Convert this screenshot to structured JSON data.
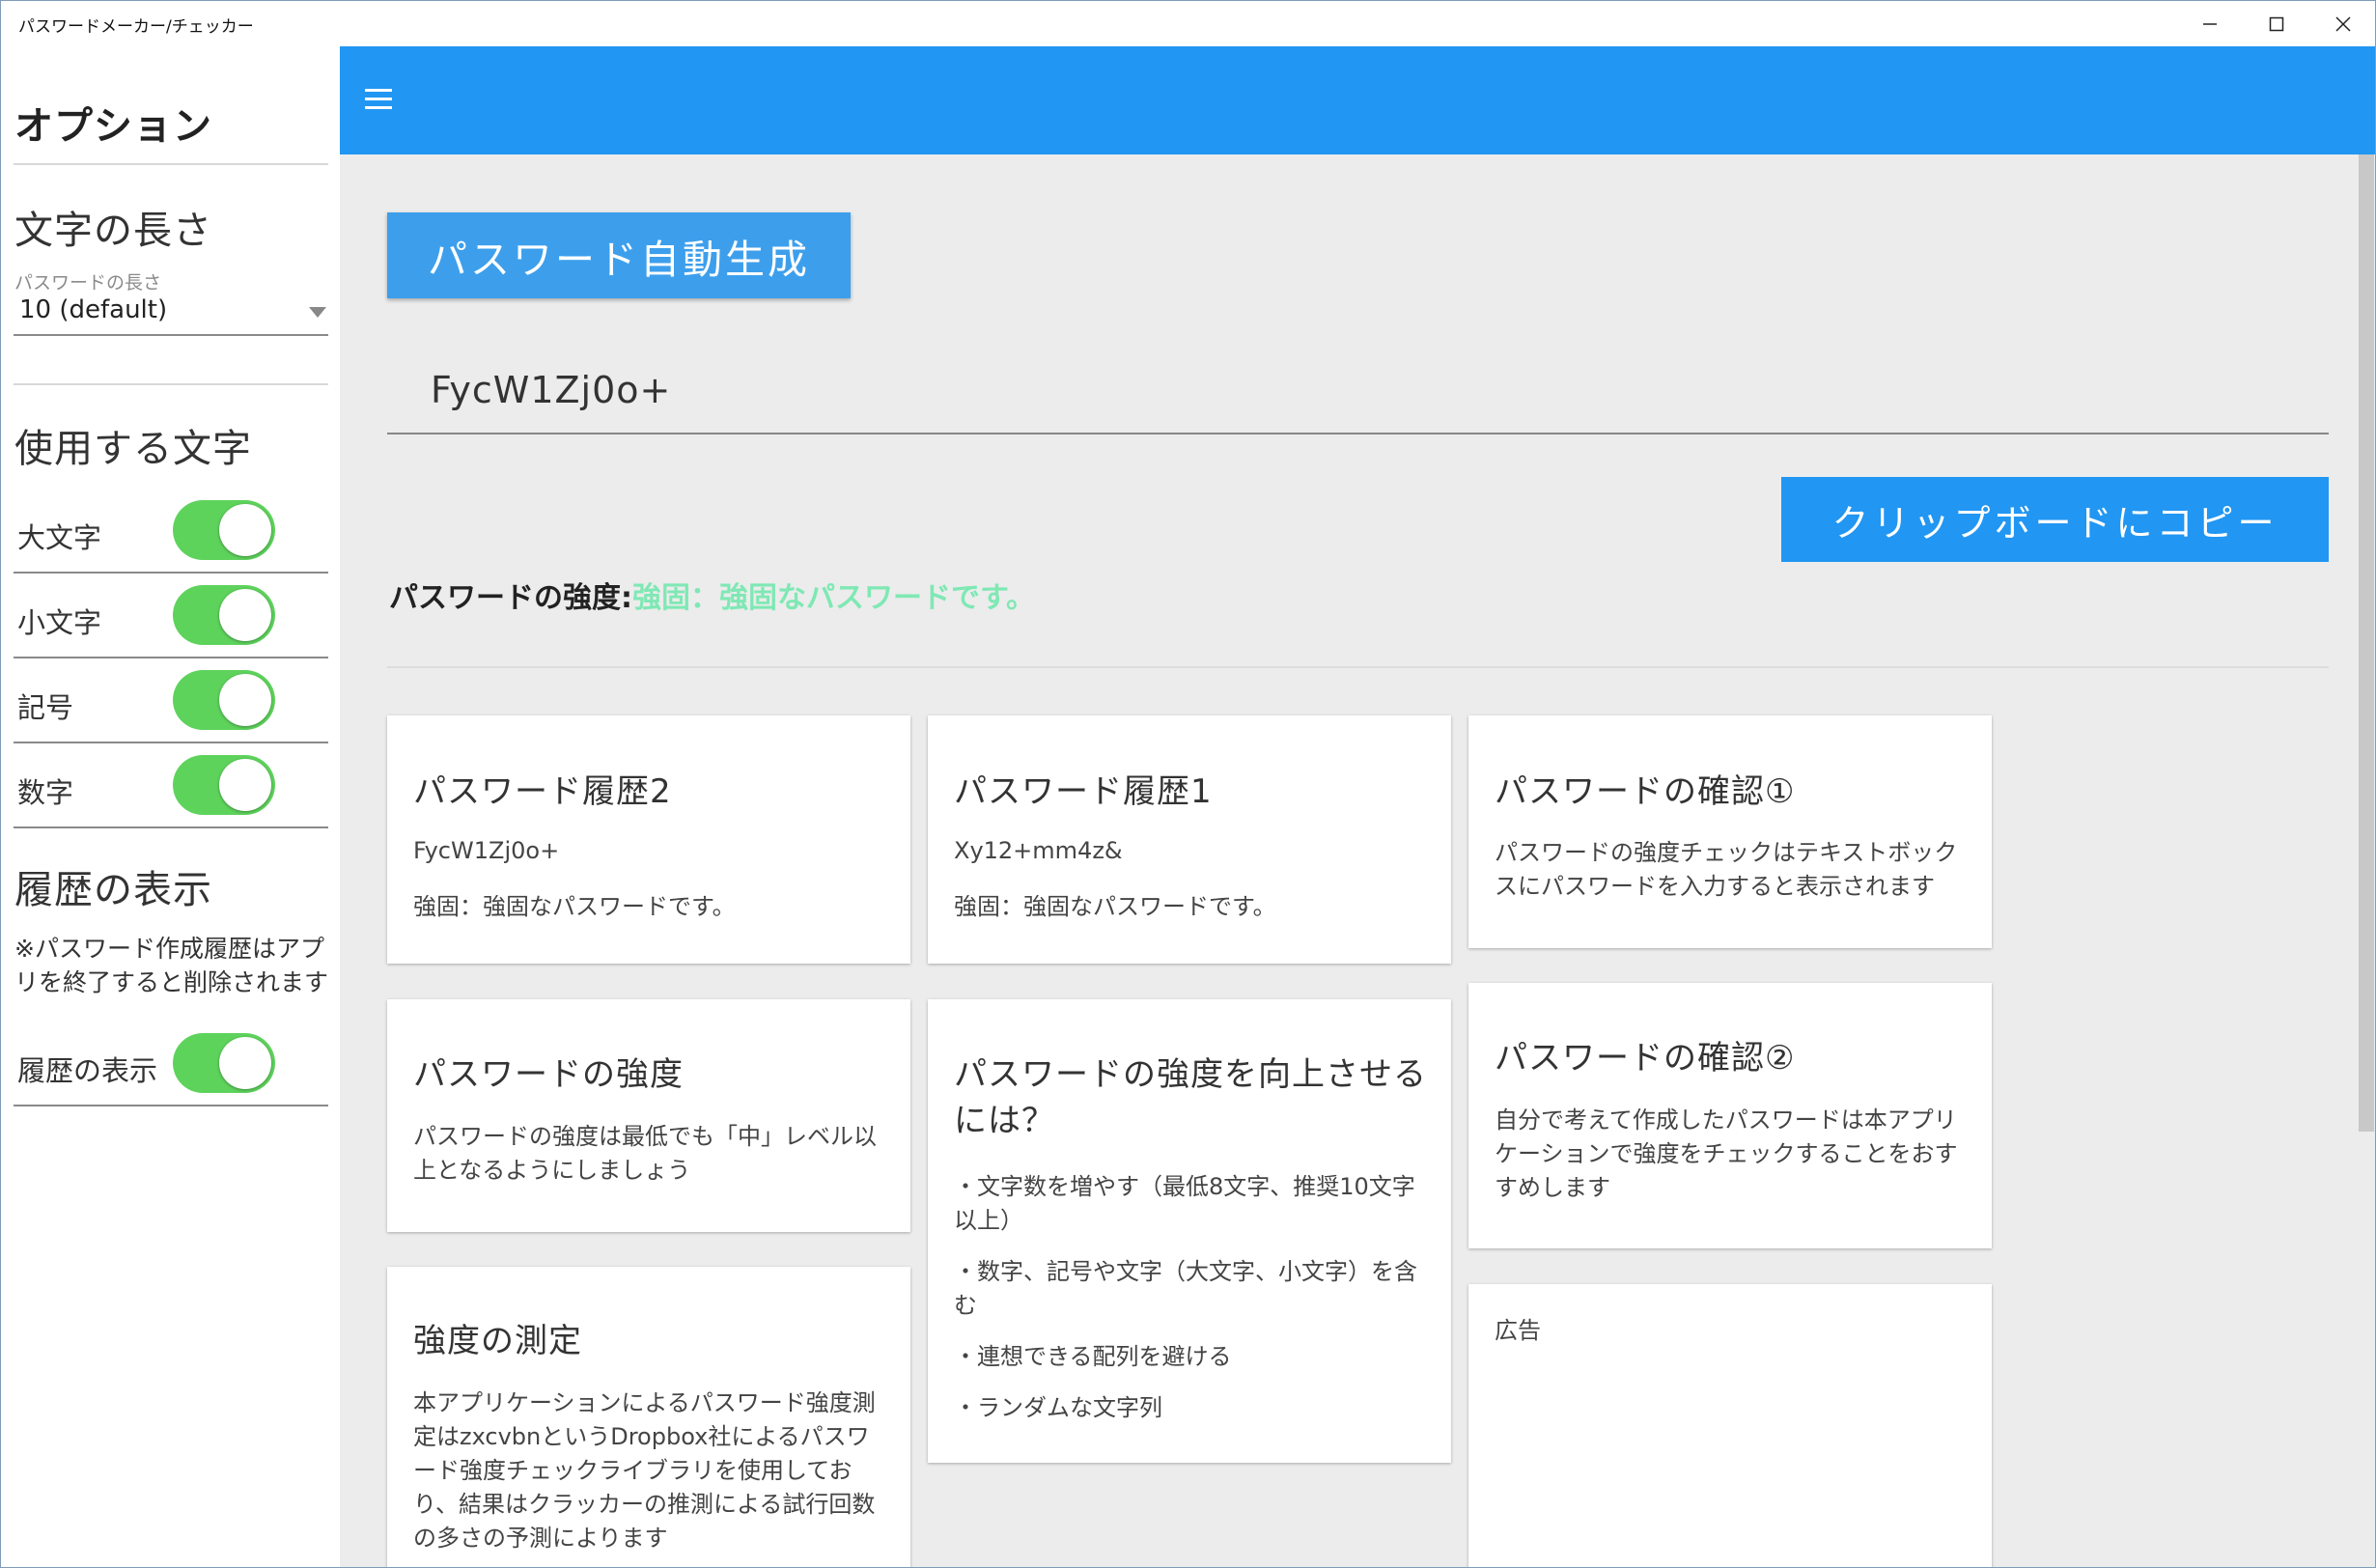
{
  "window": {
    "title": "パスワードメーカー/チェッカー"
  },
  "sidebar": {
    "title": "オプション",
    "length_section": {
      "heading": "文字の長さ",
      "field_label": "パスワードの長さ",
      "selected_value": "10 (default)"
    },
    "chars_section": {
      "heading": "使用する文字",
      "toggles": [
        {
          "label": "大文字",
          "on": true
        },
        {
          "label": "小文字",
          "on": true
        },
        {
          "label": "記号",
          "on": true
        },
        {
          "label": "数字",
          "on": true
        }
      ]
    },
    "history_section": {
      "heading": "履歴の表示",
      "note": "※パスワード作成履歴はアプリを終了すると削除されます",
      "toggle_label": "履歴の表示",
      "toggle_on": true
    }
  },
  "main": {
    "generate_button": "パスワード自動生成",
    "password_value": "FycW1Zj0o+",
    "copy_button": "クリップボードにコピー",
    "strength_label": "パスワードの強度:",
    "strength_result": "強固：強固なパスワードです。",
    "strength_color": "#7fe8b4"
  },
  "cards": {
    "history2": {
      "title": "パスワード履歴2",
      "password": "FycW1Zj0o+",
      "strength": "強固：強固なパスワードです。"
    },
    "history1": {
      "title": "パスワード履歴1",
      "password": "Xy12+mm4z&",
      "strength": "強固：強固なパスワードです。"
    },
    "confirm1": {
      "title": "パスワードの確認①",
      "text": "パスワードの強度チェックはテキストボックスにパスワードを入力すると表示されます"
    },
    "strength_info": {
      "title": "パスワードの強度",
      "text": "パスワードの強度は最低でも「中」レベル以上となるようにしましょう"
    },
    "improve": {
      "title": "パスワードの強度を向上させるには？",
      "items": [
        "・文字数を増やす（最低8文字、推奨10文字以上）",
        "・数字、記号や文字（大文字、小文字）を含む",
        "・連想できる配列を避ける",
        "・ランダムな文字列"
      ]
    },
    "confirm2": {
      "title": "パスワードの確認②",
      "text": "自分で考えて作成したパスワードは本アプリケーションで強度をチェックすることをおすすめします"
    },
    "measure": {
      "title": "強度の測定",
      "text": "本アプリケーションによるパスワード強度測定はzxcvbnというDropbox社によるパスワード強度チェックライブラリを使用しており、結果はクラッカーの推測による試行回数の多さの予測によります"
    },
    "ad": {
      "label": "広告"
    }
  },
  "colors": {
    "accent": "#2196f3",
    "button": "#3d9fec",
    "toggle_on": "#5ed35c",
    "background": "#ececec"
  }
}
